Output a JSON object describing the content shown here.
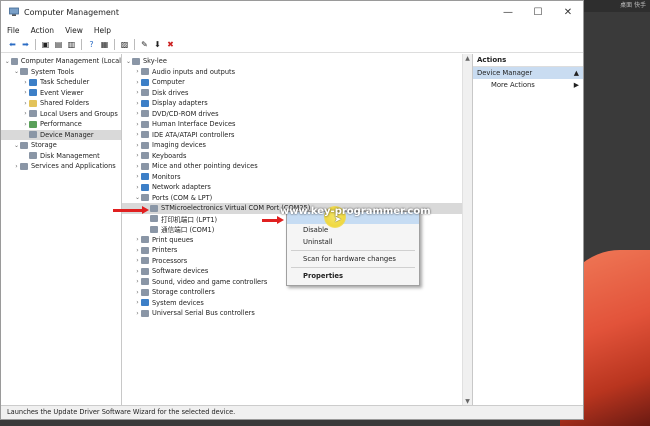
{
  "desktop": {
    "top_text": "桌面 快手"
  },
  "window": {
    "title": "Computer Management",
    "minimize": "—",
    "maximize": "☐",
    "close": "✕"
  },
  "menu": [
    "File",
    "Action",
    "View",
    "Help"
  ],
  "left_tree": [
    {
      "label": "Computer Management (Local",
      "depth": 0,
      "exp": "⌄",
      "icon": "gray"
    },
    {
      "label": "System Tools",
      "depth": 1,
      "exp": "⌄",
      "icon": "gray"
    },
    {
      "label": "Task Scheduler",
      "depth": 2,
      "exp": "›",
      "icon": "blue"
    },
    {
      "label": "Event Viewer",
      "depth": 2,
      "exp": "›",
      "icon": "blue"
    },
    {
      "label": "Shared Folders",
      "depth": 2,
      "exp": "›",
      "icon": "yellow"
    },
    {
      "label": "Local Users and Groups",
      "depth": 2,
      "exp": "›",
      "icon": "gray"
    },
    {
      "label": "Performance",
      "depth": 2,
      "exp": "›",
      "icon": "green"
    },
    {
      "label": "Device Manager",
      "depth": 2,
      "exp": "",
      "icon": "gray",
      "selected": true
    },
    {
      "label": "Storage",
      "depth": 1,
      "exp": "⌄",
      "icon": "gray"
    },
    {
      "label": "Disk Management",
      "depth": 2,
      "exp": "",
      "icon": "gray"
    },
    {
      "label": "Services and Applications",
      "depth": 1,
      "exp": "›",
      "icon": "gray"
    }
  ],
  "device_tree": [
    {
      "label": "Sky-lee",
      "depth": 0,
      "exp": "⌄",
      "icon": "gray"
    },
    {
      "label": "Audio inputs and outputs",
      "depth": 1,
      "exp": "›",
      "icon": "gray"
    },
    {
      "label": "Computer",
      "depth": 1,
      "exp": "›",
      "icon": "blue"
    },
    {
      "label": "Disk drives",
      "depth": 1,
      "exp": "›",
      "icon": "gray"
    },
    {
      "label": "Display adapters",
      "depth": 1,
      "exp": "›",
      "icon": "blue"
    },
    {
      "label": "DVD/CD-ROM drives",
      "depth": 1,
      "exp": "›",
      "icon": "gray"
    },
    {
      "label": "Human Interface Devices",
      "depth": 1,
      "exp": "›",
      "icon": "gray"
    },
    {
      "label": "IDE ATA/ATAPI controllers",
      "depth": 1,
      "exp": "›",
      "icon": "gray"
    },
    {
      "label": "Imaging devices",
      "depth": 1,
      "exp": "›",
      "icon": "gray"
    },
    {
      "label": "Keyboards",
      "depth": 1,
      "exp": "›",
      "icon": "gray"
    },
    {
      "label": "Mice and other pointing devices",
      "depth": 1,
      "exp": "›",
      "icon": "gray"
    },
    {
      "label": "Monitors",
      "depth": 1,
      "exp": "›",
      "icon": "blue"
    },
    {
      "label": "Network adapters",
      "depth": 1,
      "exp": "›",
      "icon": "blue"
    },
    {
      "label": "Ports (COM & LPT)",
      "depth": 1,
      "exp": "⌄",
      "icon": "gray"
    },
    {
      "label": "STMicroelectronics Virtual COM Port (COM25)",
      "depth": 2,
      "exp": "",
      "icon": "gray",
      "selected": true
    },
    {
      "label": "打印机端口 (LPT1)",
      "depth": 2,
      "exp": "",
      "icon": "gray"
    },
    {
      "label": "通信端口 (COM1)",
      "depth": 2,
      "exp": "",
      "icon": "gray"
    },
    {
      "label": "Print queues",
      "depth": 1,
      "exp": "›",
      "icon": "gray"
    },
    {
      "label": "Printers",
      "depth": 1,
      "exp": "›",
      "icon": "gray"
    },
    {
      "label": "Processors",
      "depth": 1,
      "exp": "›",
      "icon": "gray"
    },
    {
      "label": "Software devices",
      "depth": 1,
      "exp": "›",
      "icon": "gray"
    },
    {
      "label": "Sound, video and game controllers",
      "depth": 1,
      "exp": "›",
      "icon": "gray"
    },
    {
      "label": "Storage controllers",
      "depth": 1,
      "exp": "›",
      "icon": "gray"
    },
    {
      "label": "System devices",
      "depth": 1,
      "exp": "›",
      "icon": "blue"
    },
    {
      "label": "Universal Serial Bus controllers",
      "depth": 1,
      "exp": "›",
      "icon": "gray"
    }
  ],
  "actions": {
    "header": "Actions",
    "section": "Device Manager",
    "more": "More Actions"
  },
  "context_menu": {
    "items": [
      "",
      "Disable",
      "Uninstall",
      "Scan for hardware changes",
      "Properties"
    ],
    "watermark": "www.key-programmer.com"
  },
  "status": "Launches the Update Driver Software Wizard for the selected device."
}
